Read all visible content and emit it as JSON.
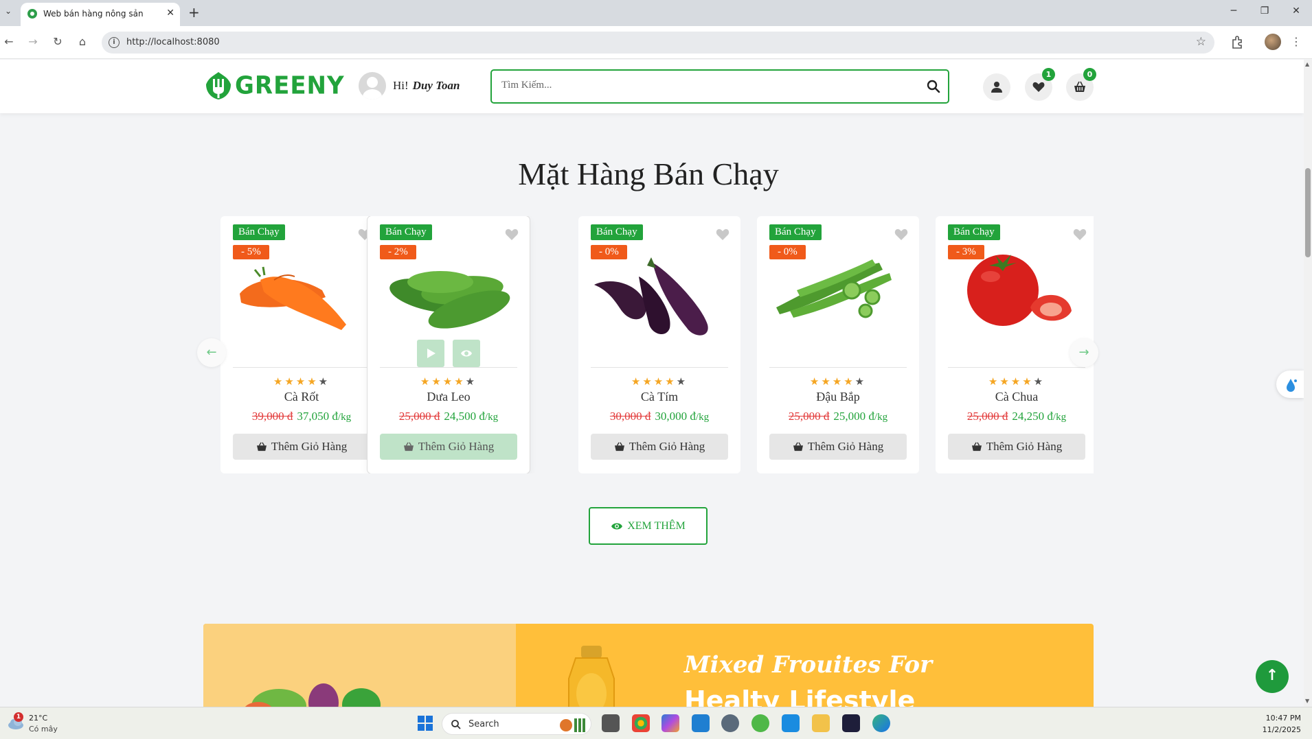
{
  "browser": {
    "tab_title": "Web bán hàng nông sản",
    "url": "http://localhost:8080"
  },
  "header": {
    "logo_text": "GREENY",
    "greeting_hi": "Hi!",
    "user_name": "Duy Toan",
    "search_placeholder": "Tìm Kiếm...",
    "wishlist_count": "1",
    "cart_count": "0"
  },
  "section": {
    "title": "Mặt Hàng Bán Chạy",
    "view_more": "XEM THÊM"
  },
  "products": [
    {
      "badge": "Bán Chạy",
      "discount": "- 5%",
      "rating": 4,
      "name": "Cà Rốt",
      "old_price": "39,000 đ",
      "new_price": "37,050 đ",
      "unit": "/kg",
      "cart_label": "Thêm Giỏ Hàng",
      "image": "carrot"
    },
    {
      "badge": "Bán Chạy",
      "discount": "- 2%",
      "rating": 4,
      "name": "Dưa Leo",
      "old_price": "25,000 đ",
      "new_price": "24,500 đ",
      "unit": "/kg",
      "cart_label": "Thêm Giỏ Hàng",
      "image": "cucumber"
    },
    {
      "badge": "Bán Chạy",
      "discount": "- 0%",
      "rating": 4,
      "name": "Cà Tím",
      "old_price": "30,000 đ",
      "new_price": "30,000 đ",
      "unit": "/kg",
      "cart_label": "Thêm Giỏ Hàng",
      "image": "eggplant"
    },
    {
      "badge": "Bán Chạy",
      "discount": "- 0%",
      "rating": 4,
      "name": "Đậu Bắp",
      "old_price": "25,000 đ",
      "new_price": "25,000 đ",
      "unit": "/kg",
      "cart_label": "Thêm Giỏ Hàng",
      "image": "okra"
    },
    {
      "badge": "Bán Chạy",
      "discount": "- 3%",
      "rating": 4,
      "name": "Cà Chua",
      "old_price": "25,000 đ",
      "new_price": "24,250 đ",
      "unit": "/kg",
      "cart_label": "Thêm Giỏ Hàng",
      "image": "tomato"
    }
  ],
  "banner": {
    "line1": "Mixed Frouites For",
    "line2": "Healty Lifestyle"
  },
  "taskbar": {
    "weather_temp": "21°C",
    "weather_desc": "Có mây",
    "weather_alerts": "1",
    "search_label": "Search",
    "time": "10:47 PM",
    "date": "11/2/2025"
  },
  "colors": {
    "brand_green": "#22a33b",
    "discount_orange": "#f05a1a",
    "price_red": "#e23a3a",
    "star": "#f5a623"
  }
}
